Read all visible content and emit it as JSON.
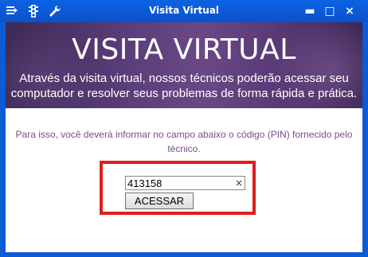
{
  "window": {
    "title": "Visita Virtual",
    "icons": [
      "menu-icon",
      "traffic-light-icon",
      "wrench-icon"
    ],
    "controls": {
      "close": "×",
      "minimize": "▬",
      "maximize": "□"
    },
    "frame_color": "#0b5bd6"
  },
  "banner": {
    "title": "VISITA VIRTUAL",
    "subtitle": "Através da visita virtual, nossos técnicos poderão acessar seu computador e resolver seus problemas de forma rápida e prática."
  },
  "instructions": "Para isso, você deverá informar no campo abaixo o código (PIN) fornecido pelo técnico.",
  "pin": {
    "value": "413158",
    "clear_glyph": "×"
  },
  "acessar_button": {
    "label": "ACESSAR"
  },
  "colors": {
    "highlight": "#e01e1e",
    "instruction_text": "#7a4a8e",
    "banner": "#5b3e7a"
  }
}
